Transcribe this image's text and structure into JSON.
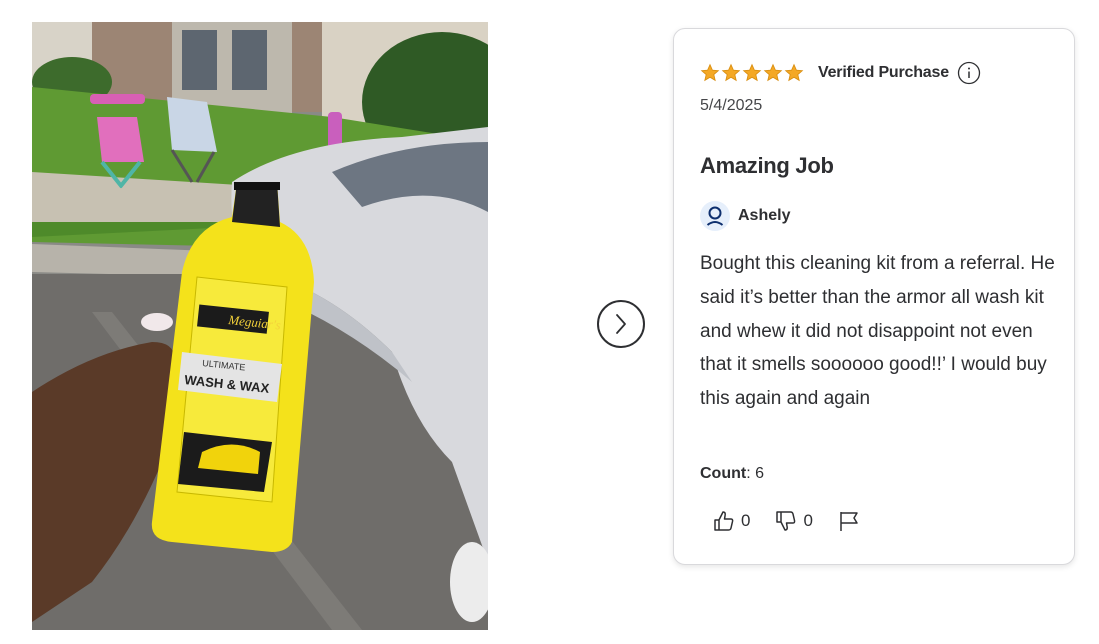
{
  "review": {
    "rating": 5,
    "rating_max": 5,
    "verified_label": "Verified Purchase",
    "date": "5/4/2025",
    "title": "Amazing Job",
    "author": "Ashely",
    "body": "Bought this cleaning kit from a referral. He said it’s better than the armor all wash kit and whew it did not disappoint not even that it smells soooooo good!!’ I would buy this again and again",
    "count_label": "Count",
    "count_value": ": 6",
    "helpful_count": "0",
    "unhelpful_count": "0"
  },
  "photo": {
    "bottle_brand": "Meguiar's",
    "bottle_line": "ULTIMATE",
    "bottle_product": "WASH & WAX"
  },
  "icons": {
    "star": "star-icon",
    "info": "info-icon",
    "avatar": "user-icon",
    "next": "chevron-right-icon",
    "thumbs_up": "thumbs-up-icon",
    "thumbs_down": "thumbs-down-icon",
    "flag": "flag-icon"
  },
  "colors": {
    "star": "#f4a825",
    "text": "#2e2f32",
    "avatar_bg": "#e6effb",
    "avatar_icon": "#0d2f6e",
    "card_border": "#d9d9dc"
  }
}
